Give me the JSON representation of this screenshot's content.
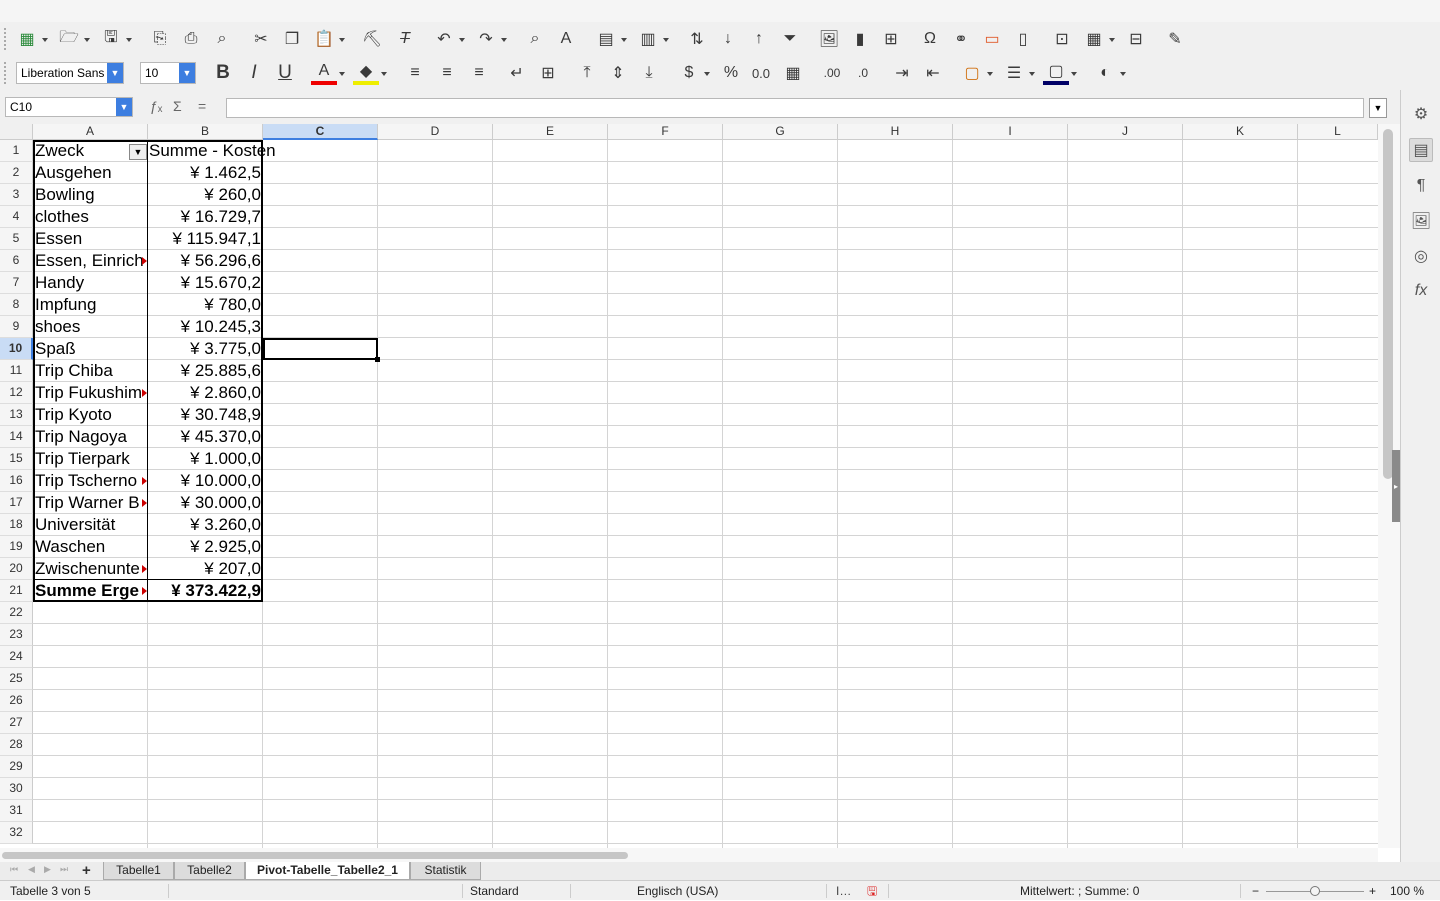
{
  "toolbar1": {
    "icons": [
      "new-document-icon",
      "open-icon",
      "save-icon",
      "export-pdf-icon",
      "print-icon",
      "print-preview-icon",
      "cut-icon",
      "copy-icon",
      "paste-icon",
      "clone-formatting-icon",
      "clear-formatting-icon",
      "undo-icon",
      "redo-icon",
      "find-replace-icon",
      "spelling-icon",
      "row-icon",
      "column-icon",
      "sort-icon",
      "sort-ascending-icon",
      "sort-descending-icon",
      "autofilter-icon",
      "insert-image-icon",
      "insert-chart-icon",
      "insert-pivot-table-icon",
      "special-character-icon",
      "hyperlink-icon",
      "comment-icon",
      "header-footer-icon",
      "define-print-area-icon",
      "freeze-rows-columns-icon",
      "split-window-icon",
      "show-draw-functions-icon"
    ]
  },
  "toolbar2": {
    "font_name": "Liberation Sans",
    "font_size": "10"
  },
  "formula": {
    "cell_ref": "C10",
    "content": ""
  },
  "columns": [
    "A",
    "B",
    "C",
    "D",
    "E",
    "F",
    "G",
    "H",
    "I",
    "J",
    "K",
    "L"
  ],
  "selected_column": "C",
  "rows": [
    "1",
    "2",
    "3",
    "4",
    "5",
    "6",
    "7",
    "8",
    "9",
    "10",
    "11",
    "12",
    "13",
    "14",
    "15",
    "16",
    "17",
    "18",
    "19",
    "20",
    "21",
    "22",
    "23",
    "24",
    "25",
    "26",
    "27",
    "28",
    "29",
    "30",
    "31",
    "32"
  ],
  "selected_row": "10",
  "pivot": {
    "header_a": "Zweck",
    "header_b": "Summe - Kosten",
    "rows": [
      {
        "label": "Ausgehen",
        "value": "¥ 1.462,5"
      },
      {
        "label": "Bowling",
        "value": "¥ 260,0"
      },
      {
        "label": "clothes",
        "value": "¥ 16.729,7"
      },
      {
        "label": "Essen",
        "value": "¥ 115.947,1"
      },
      {
        "label": "Essen, Einrich",
        "value": "¥ 56.296,6"
      },
      {
        "label": "Handy",
        "value": "¥ 15.670,2"
      },
      {
        "label": "Impfung",
        "value": "¥ 780,0"
      },
      {
        "label": "shoes",
        "value": "¥ 10.245,3"
      },
      {
        "label": "Spaß",
        "value": "¥ 3.775,0"
      },
      {
        "label": "Trip Chiba",
        "value": "¥ 25.885,6"
      },
      {
        "label": "Trip Fukushim",
        "value": "¥ 2.860,0"
      },
      {
        "label": "Trip Kyoto",
        "value": "¥ 30.748,9"
      },
      {
        "label": "Trip Nagoya",
        "value": "¥ 45.370,0"
      },
      {
        "label": "Trip Tierpark",
        "value": "¥ 1.000,0"
      },
      {
        "label": "Trip Tscherno",
        "value": "¥ 10.000,0"
      },
      {
        "label": "Trip Warner B",
        "value": "¥ 30.000,0"
      },
      {
        "label": "Universität",
        "value": "¥ 3.260,0"
      },
      {
        "label": "Waschen",
        "value": "¥ 2.925,0"
      },
      {
        "label": "Zwischenunte",
        "value": "¥ 207,0"
      }
    ],
    "total_label": "Summe Erge",
    "total_value": "¥ 373.422,9"
  },
  "sheets": {
    "tabs": [
      "Tabelle1",
      "Tabelle2",
      "Pivot-Tabelle_Tabelle2_1",
      "Statistik"
    ],
    "active": "Pivot-Tabelle_Tabelle2_1",
    "add": "+"
  },
  "status": {
    "sheet_info": "Tabelle 3 von 5",
    "page_style": "Standard",
    "language": "Englisch (USA)",
    "selection_stats": "Mittelwert: ; Summe: 0",
    "zoom_minus": "−",
    "zoom_plus": "+",
    "zoom": "100 %"
  }
}
